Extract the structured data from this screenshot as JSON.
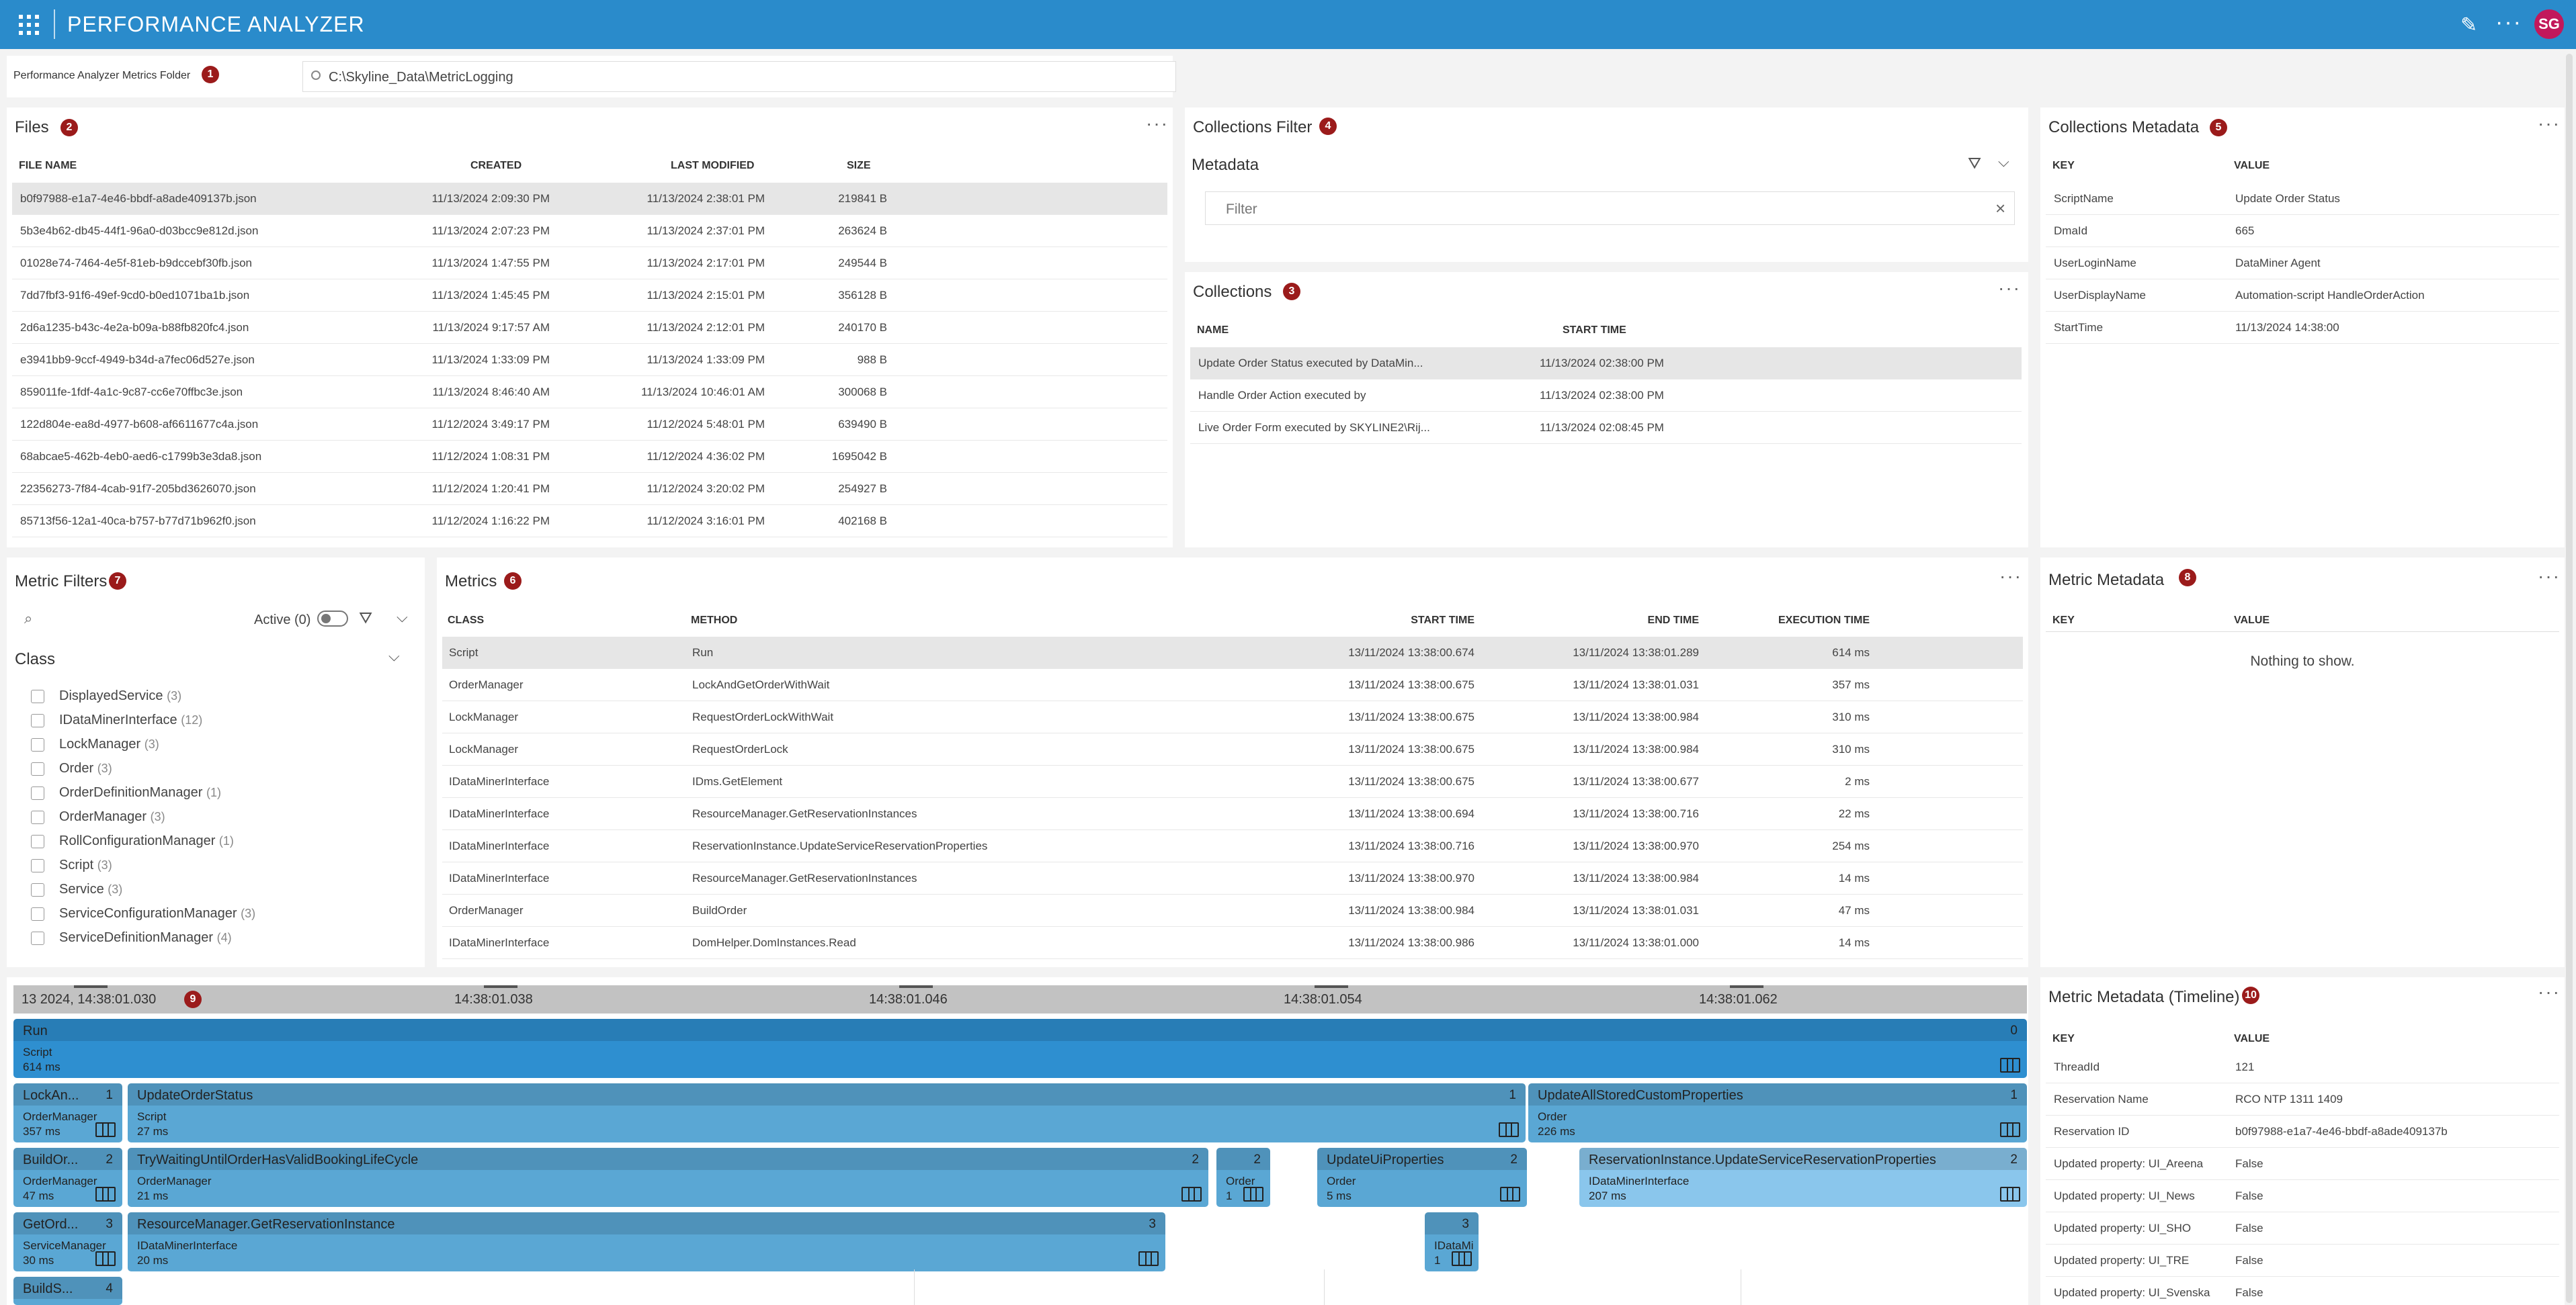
{
  "app": {
    "title": "PERFORMANCE ANALYZER",
    "avatar": "SG",
    "pencil_icon": "pencil-icon",
    "more_icon": "ellipsis-icon",
    "grid_icon": "app-grid-icon",
    "accent": "#2a8bcb",
    "badge_color": "#9b1b1b"
  },
  "folder": {
    "label": "Performance Analyzer Metrics Folder",
    "badge": "1",
    "value": "C:\\Skyline_Data\\MetricLogging"
  },
  "files": {
    "title": "Files",
    "badge": "2",
    "headers": [
      "FILE NAME",
      "CREATED",
      "LAST MODIFIED",
      "SIZE"
    ],
    "rows": [
      [
        "b0f97988-e1a7-4e46-bbdf-a8ade409137b.json",
        "11/13/2024 2:09:30 PM",
        "11/13/2024 2:38:01 PM",
        "219841 B"
      ],
      [
        "5b3e4b62-db45-44f1-96a0-d03bcc9e812d.json",
        "11/13/2024 2:07:23 PM",
        "11/13/2024 2:37:01 PM",
        "263624 B"
      ],
      [
        "01028e74-7464-4e5f-81eb-b9dccebf30fb.json",
        "11/13/2024 1:47:55 PM",
        "11/13/2024 2:17:01 PM",
        "249544 B"
      ],
      [
        "7dd7fbf3-91f6-49ef-9cd0-b0ed1071ba1b.json",
        "11/13/2024 1:45:45 PM",
        "11/13/2024 2:15:01 PM",
        "356128 B"
      ],
      [
        "2d6a1235-b43c-4e2a-b09a-b88fb820fc4.json",
        "11/13/2024 9:17:57 AM",
        "11/13/2024 2:12:01 PM",
        "240170 B"
      ],
      [
        "e3941bb9-9ccf-4949-b34d-a7fec06d527e.json",
        "11/13/2024 1:33:09 PM",
        "11/13/2024 1:33:09 PM",
        "988 B"
      ],
      [
        "859011fe-1fdf-4a1c-9c87-cc6e70ffbc3e.json",
        "11/13/2024 8:46:40 AM",
        "11/13/2024 10:46:01 AM",
        "300068 B"
      ],
      [
        "122d804e-ea8d-4977-b608-af6611677c4a.json",
        "11/12/2024 3:49:17 PM",
        "11/12/2024 5:48:01 PM",
        "639490 B"
      ],
      [
        "68abcae5-462b-4eb0-aed6-c1799b3e3da8.json",
        "11/12/2024 1:08:31 PM",
        "11/12/2024 4:36:02 PM",
        "1695042 B"
      ],
      [
        "22356273-7f84-4cab-91f7-205bd3626070.json",
        "11/12/2024 1:20:41 PM",
        "11/12/2024 3:20:02 PM",
        "254927 B"
      ],
      [
        "85713f56-12a1-40ca-b757-b77d71b962f0.json",
        "11/12/2024 1:16:22 PM",
        "11/12/2024 3:16:01 PM",
        "402168 B"
      ]
    ]
  },
  "collections_filter": {
    "title": "Collections Filter",
    "badge": "4",
    "section": "Metadata",
    "placeholder": "Filter",
    "filter_icon": "filter-icon",
    "chevron_icon": "chevron-down-icon",
    "clear_icon": "close-icon"
  },
  "collections": {
    "title": "Collections",
    "badge": "3",
    "headers": [
      "NAME",
      "START TIME"
    ],
    "rows": [
      [
        "Update Order Status executed by DataMin...",
        "11/13/2024 02:38:00 PM"
      ],
      [
        "Handle Order Action executed by",
        "11/13/2024 02:38:00 PM"
      ],
      [
        "Live Order Form executed by SKYLINE2\\Rij...",
        "11/13/2024 02:08:45 PM"
      ]
    ]
  },
  "collections_metadata": {
    "title": "Collections Metadata",
    "badge": "5",
    "headers": [
      "KEY",
      "VALUE"
    ],
    "rows": [
      [
        "ScriptName",
        "Update Order Status"
      ],
      [
        "DmaId",
        "665"
      ],
      [
        "UserLoginName",
        "DataMiner Agent"
      ],
      [
        "UserDisplayName",
        "Automation-script HandleOrderAction"
      ],
      [
        "StartTime",
        "11/13/2024 14:38:00"
      ]
    ]
  },
  "metric_filters": {
    "title": "Metric Filters",
    "badge": "7",
    "active_label": "Active (0)",
    "search_icon": "search-icon",
    "section": "Class",
    "items": [
      [
        "DisplayedService",
        "(3)"
      ],
      [
        "IDataMinerInterface",
        "(12)"
      ],
      [
        "LockManager",
        "(3)"
      ],
      [
        "Order",
        "(3)"
      ],
      [
        "OrderDefinitionManager",
        "(1)"
      ],
      [
        "OrderManager",
        "(3)"
      ],
      [
        "RollConfigurationManager",
        "(1)"
      ],
      [
        "Script",
        "(3)"
      ],
      [
        "Service",
        "(3)"
      ],
      [
        "ServiceConfigurationManager",
        "(3)"
      ],
      [
        "ServiceDefinitionManager",
        "(4)"
      ]
    ]
  },
  "metrics": {
    "title": "Metrics",
    "badge": "6",
    "headers": [
      "CLASS",
      "METHOD",
      "START TIME",
      "END TIME",
      "EXECUTION TIME"
    ],
    "rows": [
      [
        "Script",
        "Run",
        "13/11/2024 13:38:00.674",
        "13/11/2024 13:38:01.289",
        "614 ms"
      ],
      [
        "OrderManager",
        "LockAndGetOrderWithWait",
        "13/11/2024 13:38:00.675",
        "13/11/2024 13:38:01.031",
        "357 ms"
      ],
      [
        "LockManager",
        "RequestOrderLockWithWait",
        "13/11/2024 13:38:00.675",
        "13/11/2024 13:38:00.984",
        "310 ms"
      ],
      [
        "LockManager",
        "RequestOrderLock",
        "13/11/2024 13:38:00.675",
        "13/11/2024 13:38:00.984",
        "310 ms"
      ],
      [
        "IDataMinerInterface",
        "IDms.GetElement",
        "13/11/2024 13:38:00.675",
        "13/11/2024 13:38:00.677",
        "2 ms"
      ],
      [
        "IDataMinerInterface",
        "ResourceManager.GetReservationInstances",
        "13/11/2024 13:38:00.694",
        "13/11/2024 13:38:00.716",
        "22 ms"
      ],
      [
        "IDataMinerInterface",
        "ReservationInstance.UpdateServiceReservationProperties",
        "13/11/2024 13:38:00.716",
        "13/11/2024 13:38:00.970",
        "254 ms"
      ],
      [
        "IDataMinerInterface",
        "ResourceManager.GetReservationInstances",
        "13/11/2024 13:38:00.970",
        "13/11/2024 13:38:00.984",
        "14 ms"
      ],
      [
        "OrderManager",
        "BuildOrder",
        "13/11/2024 13:38:00.984",
        "13/11/2024 13:38:01.031",
        "47 ms"
      ],
      [
        "IDataMinerInterface",
        "DomHelper.DomInstances.Read",
        "13/11/2024 13:38:00.986",
        "13/11/2024 13:38:01.000",
        "14 ms"
      ]
    ]
  },
  "metric_metadata": {
    "title": "Metric Metadata",
    "badge": "8",
    "headers": [
      "KEY",
      "VALUE"
    ],
    "empty": "Nothing to show."
  },
  "timeline": {
    "badge": "9",
    "start_label": "13 2024, 14:38:01.030",
    "ticks": [
      "14:38:01.038",
      "14:38:01.046",
      "14:38:01.054",
      "14:38:01.062"
    ],
    "bars": [
      {
        "name": "Run",
        "num": "0",
        "cls": "Script",
        "time": "614 ms"
      },
      {
        "name": "LockAn...",
        "num": "1",
        "cls": "OrderManager",
        "time": "357 ms"
      },
      {
        "name": "UpdateOrderStatus",
        "num": "1",
        "cls": "Script",
        "time": "27 ms"
      },
      {
        "name": "UpdateAllStoredCustomProperties",
        "num": "1",
        "cls": "Order",
        "time": "226 ms"
      },
      {
        "name": "BuildOr...",
        "num": "2",
        "cls": "OrderManager",
        "time": "47 ms"
      },
      {
        "name": "TryWaitingUntilOrderHasValidBookingLifeCycle",
        "num": "2",
        "cls": "OrderManager",
        "time": "21 ms"
      },
      {
        "name": "",
        "num": "2",
        "cls": "Order",
        "time": "1"
      },
      {
        "name": "UpdateUiProperties",
        "num": "2",
        "cls": "Order",
        "time": "5 ms"
      },
      {
        "name": "ReservationInstance.UpdateServiceReservationProperties",
        "num": "2",
        "cls": "IDataMinerInterface",
        "time": "207 ms"
      },
      {
        "name": "GetOrd...",
        "num": "3",
        "cls": "ServiceManager",
        "time": "30 ms"
      },
      {
        "name": "ResourceManager.GetReservationInstance",
        "num": "3",
        "cls": "IDataMinerInterface",
        "time": "20 ms"
      },
      {
        "name": "",
        "num": "3",
        "cls": "IDataMi",
        "time": "1"
      },
      {
        "name": "BuildS...",
        "num": "4",
        "cls": "",
        "time": ""
      }
    ]
  },
  "timeline_metadata": {
    "title": "Metric Metadata (Timeline)",
    "badge": "10",
    "headers": [
      "KEY",
      "VALUE"
    ],
    "rows": [
      [
        "ThreadId",
        "121"
      ],
      [
        "Reservation Name",
        "RCO NTP 1311 1409"
      ],
      [
        "Reservation ID",
        "b0f97988-e1a7-4e46-bbdf-a8ade409137b"
      ],
      [
        "Updated property: UI_Areena",
        "False"
      ],
      [
        "Updated property: UI_News",
        "False"
      ],
      [
        "Updated property: UI_SHO",
        "False"
      ],
      [
        "Updated property: UI_TRE",
        "False"
      ],
      [
        "Updated property: UI_Svenska",
        "False"
      ]
    ]
  }
}
